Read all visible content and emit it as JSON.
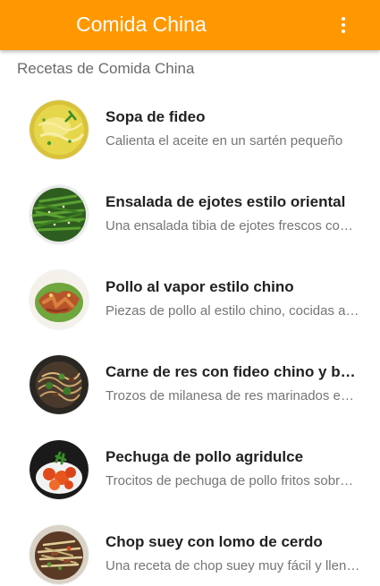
{
  "app_bar": {
    "title": "Comida China",
    "overflow_icon": "more-vert-icon",
    "background_color": "#ff9800"
  },
  "section_header": "Recetas de Comida China",
  "recipes": [
    {
      "title": "Sopa de fideo",
      "description": "Calienta el aceite en un sartén pequeño",
      "image_icon": "noodle-soup-icon"
    },
    {
      "title": "Ensalada de ejotes estilo oriental",
      "description": "Una ensalada tibia de ejotes frescos con ajonjolí",
      "image_icon": "green-bean-salad-icon"
    },
    {
      "title": "Pollo al vapor estilo chino",
      "description": "Piezas de pollo al estilo chino, cocidas al vapor",
      "image_icon": "steamed-chicken-icon"
    },
    {
      "title": "Carne de res con fideo chino y brócoli",
      "description": "Trozos de milanesa de res marinados en salsa",
      "image_icon": "beef-noodles-icon"
    },
    {
      "title": "Pechuga de pollo agridulce",
      "description": "Trocitos de pechuga de pollo fritos sobre salsa",
      "image_icon": "sweet-sour-chicken-icon"
    },
    {
      "title": "Chop suey con lomo de cerdo",
      "description": "Una receta de chop suey muy fácil y llena de sabor",
      "image_icon": "chop-suey-icon"
    }
  ]
}
